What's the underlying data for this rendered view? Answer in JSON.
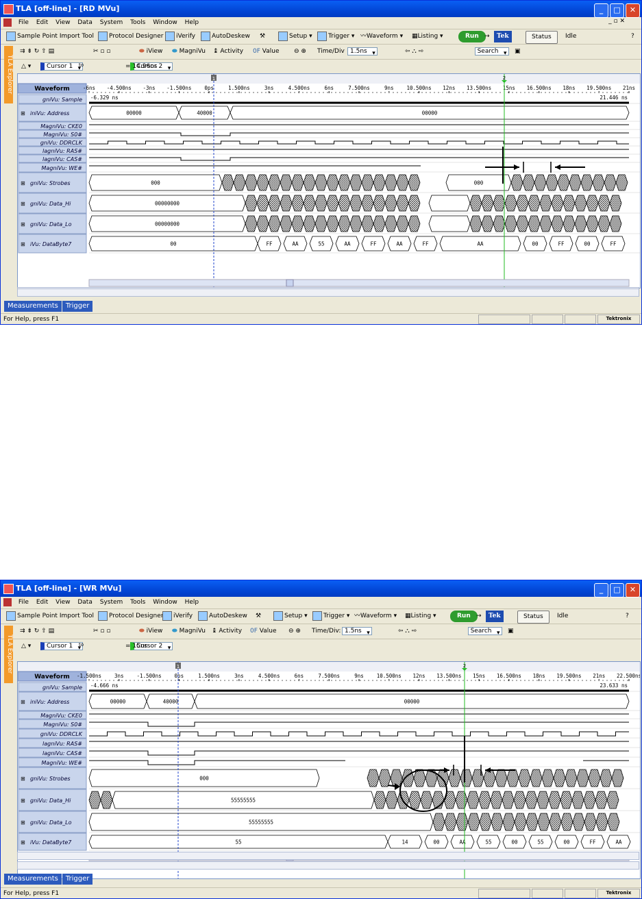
{
  "windows": [
    {
      "title": "TLA [off-line] - [RD MVu]",
      "menu": [
        "File",
        "Edit",
        "View",
        "Data",
        "System",
        "Tools",
        "Window",
        "Help"
      ],
      "toolbar1": {
        "sample_point": "Sample Point Import Tool",
        "protocol": "Protocol Designer",
        "iverify": "iVerify",
        "autodeskew": "AutoDeskew",
        "setup": "Setup",
        "trigger": "Trigger",
        "waveform": "Waveform",
        "listing": "Listing",
        "run": "Run",
        "tek": "Tek",
        "status": "Status",
        "status_value": "Idle"
      },
      "toolbar2": {
        "iview": "iView",
        "magnivu": "MagniVu",
        "activity": "Activity",
        "value": "Value",
        "time_div_label": "Time/Div",
        "time_div": "1.5ns",
        "search": "Search"
      },
      "cursor_bar": {
        "cursor1": "Cursor 1",
        "to": "to",
        "cursor2": "Cursor 2",
        "delta": "= 14.96ns"
      },
      "side_tab": "TLA Explorer",
      "header": "Waveform",
      "ticks": [
        "-6ns",
        "-4.500ns",
        "-3ns",
        "-1.500ns",
        "0ps",
        "1.500ns",
        "3ns",
        "4.500ns",
        "6ns",
        "7.500ns",
        "9ns",
        "10.500ns",
        "12ns",
        "13.500ns",
        "15ns",
        "16.500ns",
        "18ns",
        "19.500ns",
        "21ns"
      ],
      "sample_left": "-6.329 ns",
      "sample_right": "21.446 ns",
      "signals": [
        {
          "name": "gniVu: Sample",
          "group": false
        },
        {
          "name": "iniVu: Address",
          "group": true
        },
        {
          "name": "MagniVu: CKE0",
          "group": false
        },
        {
          "name": "MagniVu: S0#",
          "group": false
        },
        {
          "name": "gniVu: DDRCLK",
          "group": false
        },
        {
          "name": "lagniVu: RAS#",
          "group": false
        },
        {
          "name": "lagniVu: CAS#",
          "group": false
        },
        {
          "name": "MagniVu: WE#",
          "group": false
        },
        {
          "name": "gniVu: Strobes",
          "group": true
        },
        {
          "name": "gniVu: Data_Hi",
          "group": true
        },
        {
          "name": "gniVu: Data_Lo",
          "group": true
        },
        {
          "name": "iVu: DataByte7",
          "group": true
        }
      ],
      "values": {
        "addr1": "00000",
        "addr2": "40000",
        "addr3": "00000",
        "strobes": "000",
        "strobes2": "000",
        "data_hi": "00000000",
        "data_lo": "00000000",
        "byte_start": "00",
        "bytes": [
          "FF",
          "AA",
          "55",
          "AA",
          "FF",
          "AA",
          "FF"
        ],
        "byte_mid": "AA",
        "bytes_end": [
          "00",
          "FF",
          "00",
          "FF"
        ]
      },
      "bottom_tabs": [
        "Measurements",
        "Trigger"
      ],
      "status_text": "For Help, press F1",
      "brand": "Tektronix",
      "cursor_labels": [
        "1",
        "2"
      ]
    },
    {
      "title": "TLA [off-line] - [WR MVu]",
      "menu": [
        "File",
        "Edit",
        "View",
        "Data",
        "System",
        "Tools",
        "Window",
        "Help"
      ],
      "toolbar1": {
        "sample_point": "Sample Point Import Tool",
        "protocol": "Protocol Designer",
        "iverify": "iVerify",
        "autodeskew": "AutoDeskew",
        "setup": "Setup",
        "trigger": "Trigger",
        "waveform": "Waveform",
        "listing": "Listing",
        "run": "Run",
        "tek": "Tek",
        "status": "Status",
        "status_value": "Idle"
      },
      "toolbar2": {
        "iview": "iView",
        "magnivu": "MagniVu",
        "activity": "Activity",
        "value": "Value",
        "time_div_label": "Time/Div:",
        "time_div": "1.5ns",
        "search": "Search"
      },
      "cursor_bar": {
        "cursor1": "Cursor 1",
        "to": "to",
        "cursor2": "Cursor 2",
        "delta": "= 15ns"
      },
      "side_tab": "TLA Explorer",
      "header": "Waveform",
      "ticks": [
        "-1.500ns",
        "3ns",
        "-1.500ns",
        "0ps",
        "1.500ns",
        "3ns",
        "4.500ns",
        "6ns",
        "7.500ns",
        "9ns",
        "10.500ns",
        "12ns",
        "13.500ns",
        "15ns",
        "16.500ns",
        "18ns",
        "19.500ns",
        "21ns",
        "22.500ns"
      ],
      "sample_left": "-4.666 ns",
      "sample_right": "23.633 ns",
      "signals": [
        {
          "name": "gniVu: Sample",
          "group": false
        },
        {
          "name": "iniVu: Address",
          "group": true
        },
        {
          "name": "MagniVu: CKE0",
          "group": false
        },
        {
          "name": "MagniVu: S0#",
          "group": false
        },
        {
          "name": "gniVu: DDRCLK",
          "group": false
        },
        {
          "name": "lagniVu: RAS#",
          "group": false
        },
        {
          "name": "lagniVu: CAS#",
          "group": false
        },
        {
          "name": "MagniVu: WE#",
          "group": false
        },
        {
          "name": "gniVu: Strobes",
          "group": true
        },
        {
          "name": "gniVu: Data_Hi",
          "group": true
        },
        {
          "name": "gniVu: Data_Lo",
          "group": true
        },
        {
          "name": "iVu: DataByte7",
          "group": true
        }
      ],
      "values": {
        "addr1": "00000",
        "addr2": "40000",
        "addr3": "00000",
        "strobes": "000",
        "data_hi": "55555555",
        "data_lo": "55555555",
        "byte_start": "55",
        "bytes": [
          "14",
          "00",
          "AA",
          "55",
          "00",
          "55",
          "00",
          "FF",
          "AA"
        ]
      },
      "bottom_tabs": [
        "Measurements",
        "Trigger"
      ],
      "status_text": "For Help, press F1",
      "brand": "Tektronix",
      "cursor_labels": [
        "1",
        "2"
      ]
    }
  ]
}
